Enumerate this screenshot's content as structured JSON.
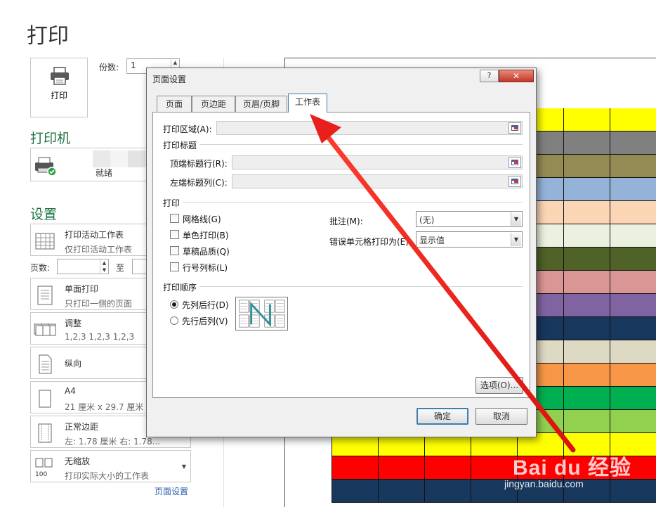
{
  "backstage": {
    "title": "打印",
    "print_button": "打印",
    "copies_label": "份数:",
    "copies_value": "1",
    "printer_heading": "打印机",
    "printer_status": "就绪",
    "settings_heading": "设置",
    "options": [
      {
        "line1": "打印活动工作表",
        "line2": "仅打印活动工作表"
      },
      {
        "line1": "单面打印",
        "line2": "只打印一侧的页面"
      },
      {
        "line1": "调整",
        "line2": "1,2,3    1,2,3    1,2,3"
      },
      {
        "line1": "纵向",
        "line2": ""
      },
      {
        "line1": "A4",
        "line2": "21 厘米 x 29.7 厘米"
      },
      {
        "line1": "正常边距",
        "line2": "左: 1.78 厘米    右: 1.78..."
      },
      {
        "line1": "无缩放",
        "line2": "打印实际大小的工作表"
      }
    ],
    "pages_label": "页数:",
    "to_label": "至",
    "page_setup_link": "页面设置"
  },
  "preview": {
    "row_colors": [
      "#ffff00",
      "#808080",
      "#948a54",
      "#95b3d7",
      "#fcd5b4",
      "#ebf1de",
      "#4f6228",
      "#da9694",
      "#8064a2",
      "#17375d",
      "#ddd9c3",
      "#f79646",
      "#00b050",
      "#92d050",
      "#ffff00",
      "#ff0000",
      "#17375d"
    ]
  },
  "dialog": {
    "title": "页面设置",
    "help": "?",
    "close": "✕",
    "tabs": [
      "页面",
      "页边距",
      "页眉/页脚",
      "工作表"
    ],
    "active_tab": "工作表",
    "print_area_label": "打印区域(A):",
    "print_titles_group": "打印标题",
    "top_rows_label": "顶端标题行(R):",
    "left_cols_label": "左端标题列(C):",
    "print_group": "打印",
    "checkboxes": [
      "网格线(G)",
      "单色打印(B)",
      "草稿品质(Q)",
      "行号列标(L)"
    ],
    "comments_label": "批注(M):",
    "comments_value": "(无)",
    "errors_label": "错误单元格打印为(E):",
    "errors_value": "显示值",
    "order_group": "打印顺序",
    "radios": [
      "先列后行(D)",
      "先行后列(V)"
    ],
    "options_button": "选项(O)...",
    "ok_button": "确定",
    "cancel_button": "取消"
  },
  "watermark": {
    "brand": "Bai du 经验",
    "url": "jingyan.baidu.com"
  },
  "colors": {
    "accent_green": "#217346",
    "arrow_red": "#e8201c",
    "link_blue": "#2a5daa"
  }
}
